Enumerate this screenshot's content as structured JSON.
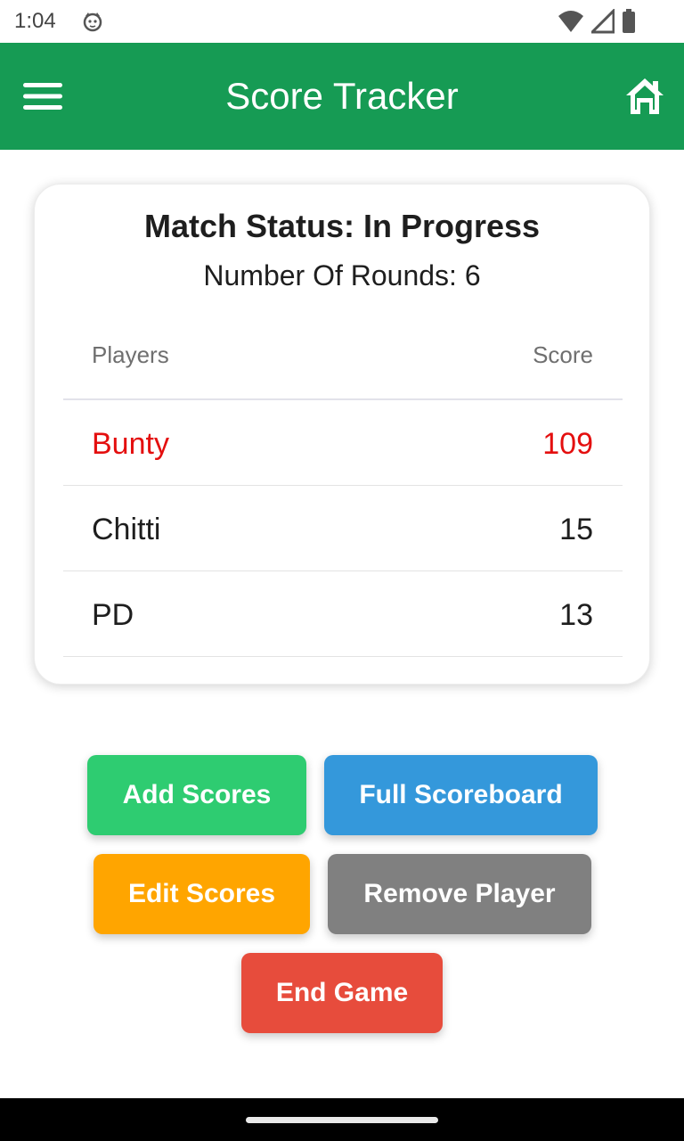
{
  "status_bar": {
    "time": "1:04",
    "icons": [
      "cat-notification-icon",
      "wifi-icon",
      "signal-icon",
      "battery-icon"
    ]
  },
  "app_bar": {
    "title": "Score Tracker",
    "menu_icon": "hamburger-menu-icon",
    "home_icon": "home-icon",
    "background": "#169b54"
  },
  "match": {
    "status": "Match Status: In Progress",
    "rounds": "Number Of Rounds: 6",
    "columns": {
      "players": "Players",
      "score": "Score"
    },
    "players": [
      {
        "name": "Bunty",
        "score": "109",
        "leader": true
      },
      {
        "name": "Chitti",
        "score": "15",
        "leader": false
      },
      {
        "name": "PD",
        "score": "13",
        "leader": false
      }
    ],
    "leader_color": "#e40f0f"
  },
  "actions": {
    "add_scores": "Add Scores",
    "full_scoreboard": "Full Scoreboard",
    "edit_scores": "Edit Scores",
    "remove_player": "Remove Player",
    "end_game": "End Game",
    "colors": {
      "add_scores": "#2ecc71",
      "full_scoreboard": "#3498db",
      "edit_scores": "#ffa500",
      "remove_player": "#808080",
      "end_game": "#e74c3c"
    }
  }
}
